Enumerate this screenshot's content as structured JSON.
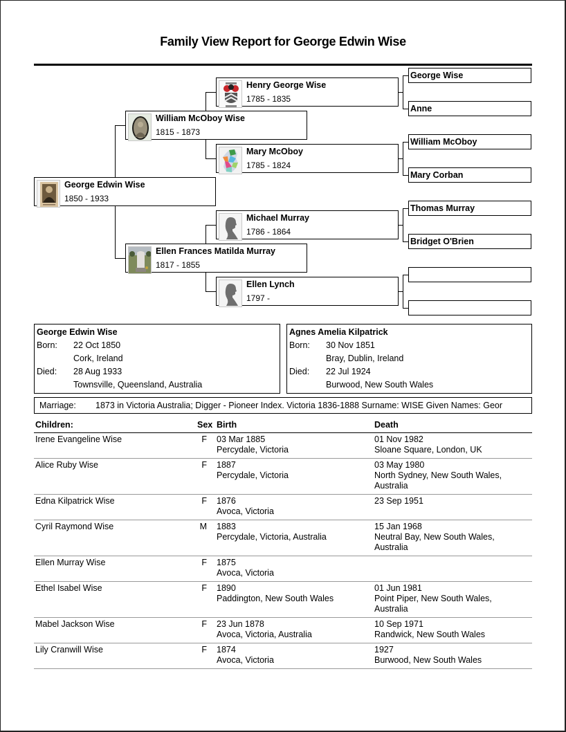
{
  "report": {
    "title": "Family View Report for George Edwin Wise"
  },
  "pedigree": {
    "root": {
      "name": "George Edwin Wise",
      "dates": "1850 - 1933",
      "thumb": "sepia-portrait-photo"
    },
    "father": {
      "name": "William McOboy Wise",
      "dates": "1815 - 1873",
      "thumb": "oval-portrait-photo"
    },
    "mother": {
      "name": "Ellen Frances Matilda Murray",
      "dates": "1817 - 1855",
      "thumb": "headstone-photo"
    },
    "paternal_grandfather": {
      "name": "Henry George Wise",
      "dates": "1785 - 1835",
      "thumb": "coat-of-arms-image"
    },
    "paternal_grandmother": {
      "name": "Mary McOboy",
      "dates": "1785 - 1824",
      "thumb": "ireland-map-image"
    },
    "maternal_grandfather": {
      "name": "Michael Murray",
      "dates": "1786 - 1864",
      "thumb": "silhouette-placeholder"
    },
    "maternal_grandmother": {
      "name": "Ellen Lynch",
      "dates": "1797 -",
      "thumb": "silhouette-placeholder"
    },
    "great_grandparents": [
      {
        "name": "George Wise"
      },
      {
        "name": "Anne"
      },
      {
        "name": "William McOboy"
      },
      {
        "name": "Mary Corban"
      },
      {
        "name": "Thomas Murray"
      },
      {
        "name": "Bridget O'Brien"
      },
      {
        "name": ""
      },
      {
        "name": ""
      }
    ]
  },
  "husband": {
    "name": "George Edwin Wise",
    "born_label": "Born:",
    "born_date": "22 Oct 1850",
    "born_place": "Cork, Ireland",
    "died_label": "Died:",
    "died_date": "28 Aug 1933",
    "died_place": "Townsville, Queensland, Australia"
  },
  "wife": {
    "name": "Agnes Amelia Kilpatrick",
    "born_label": "Born:",
    "born_date": "30 Nov 1851",
    "born_place": "Bray, Dublin, Ireland",
    "died_label": "Died:",
    "died_date": "22 Jul 1924",
    "died_place": "Burwood, New South Wales"
  },
  "marriage": {
    "label": "Marriage:",
    "value": "1873 in Victoria Australia; Digger - Pioneer Index. Victoria 1836-1888 Surname: WISE Given Names: Geor"
  },
  "children": {
    "headers": {
      "name": "Children:",
      "sex": "Sex",
      "birth": "Birth",
      "death": "Death"
    },
    "rows": [
      {
        "name": "Irene Evangeline Wise",
        "sex": "F",
        "birth_date": "03 Mar 1885",
        "birth_place": "Percydale, Victoria",
        "death_date": "01 Nov 1982",
        "death_place": "Sloane Square, London, UK"
      },
      {
        "name": "Alice Ruby Wise",
        "sex": "F",
        "birth_date": "1887",
        "birth_place": "Percydale, Victoria",
        "death_date": "03 May 1980",
        "death_place": "North Sydney, New South Wales,\nAustralia"
      },
      {
        "name": "Edna Kilpatrick Wise",
        "sex": "F",
        "birth_date": "1876",
        "birth_place": "Avoca, Victoria",
        "death_date": "23 Sep 1951",
        "death_place": ""
      },
      {
        "name": "Cyril Raymond Wise",
        "sex": "M",
        "birth_date": "1883",
        "birth_place": "Percydale, Victoria, Australia",
        "death_date": "15 Jan 1968",
        "death_place": "Neutral Bay, New South Wales,\nAustralia"
      },
      {
        "name": "Ellen Murray Wise",
        "sex": "F",
        "birth_date": "1875",
        "birth_place": "Avoca, Victoria",
        "death_date": "",
        "death_place": ""
      },
      {
        "name": "Ethel Isabel Wise",
        "sex": "F",
        "birth_date": "1890",
        "birth_place": "Paddington, New South Wales",
        "death_date": "01 Jun 1981",
        "death_place": "Point Piper, New South Wales,\nAustralia"
      },
      {
        "name": "Mabel Jackson Wise",
        "sex": "F",
        "birth_date": "23 Jun 1878",
        "birth_place": "Avoca, Victoria, Australia",
        "death_date": "10 Sep 1971",
        "death_place": "Randwick, New South Wales"
      },
      {
        "name": "Lily Cranwill Wise",
        "sex": "F",
        "birth_date": "1874",
        "birth_place": "Avoca, Victoria",
        "death_date": "1927",
        "death_place": "Burwood, New South Wales"
      }
    ]
  }
}
